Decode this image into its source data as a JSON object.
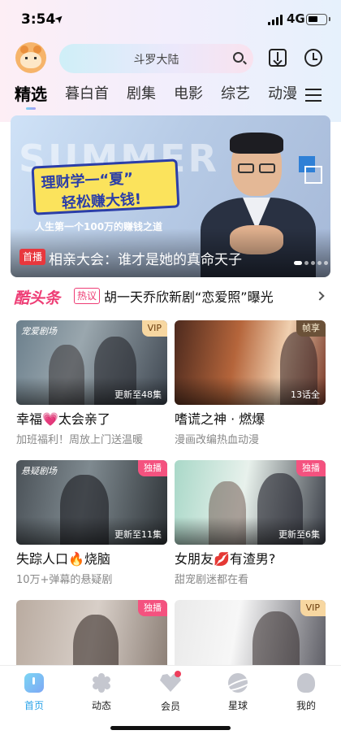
{
  "status_bar": {
    "time": "3:54",
    "network": "4G"
  },
  "header": {
    "search_placeholder": "斗罗大陆"
  },
  "tabs": [
    {
      "label": "精选",
      "active": true
    },
    {
      "label": "暮白首",
      "active": false
    },
    {
      "label": "剧集",
      "active": false
    },
    {
      "label": "电影",
      "active": false
    },
    {
      "label": "综艺",
      "active": false
    },
    {
      "label": "动漫",
      "active": false
    }
  ],
  "banner": {
    "bg_text": "SUMMER",
    "promo_line1": "理财学一“夏”",
    "promo_line2": "轻松赚大钱!",
    "promo_sub": "人生第一个100万的赚钱之道",
    "badge": "首播",
    "title": "相亲大会：谁才是她的真命天子",
    "pages": 5,
    "current_page": 1
  },
  "headline": {
    "logo": "酷头条",
    "tag": "热议",
    "text": "胡一天乔欣新剧“恋爱照”曝光"
  },
  "cards": [
    {
      "title": "幸福💗太会亲了",
      "subtitle": "加班福利！周放上门送温暖",
      "badge": "VIP",
      "badge_type": "vip",
      "episode": "更新至48集",
      "logo": "宠爱剧场"
    },
    {
      "title": "嗜谎之神 · 燃爆",
      "subtitle": "漫画改编热血动漫",
      "badge": "帧享",
      "badge_type": "dark",
      "episode": "13话全",
      "logo": ""
    },
    {
      "title": "失踪人口🔥烧脑",
      "subtitle": "10万+弹幕的悬疑剧",
      "badge": "独播",
      "badge_type": "excl",
      "episode": "更新至11集",
      "logo": "悬疑剧场"
    },
    {
      "title": "女朋友💋有渣男?",
      "subtitle": "甜宠剧迷都在看",
      "badge": "独播",
      "badge_type": "excl",
      "episode": "更新至6集",
      "logo": ""
    },
    {
      "title": "",
      "subtitle": "",
      "badge": "独播",
      "badge_type": "excl",
      "episode": "",
      "logo": ""
    },
    {
      "title": "",
      "subtitle": "",
      "badge": "VIP",
      "badge_type": "vip",
      "episode": "",
      "logo": ""
    }
  ],
  "bottom_nav": [
    {
      "label": "首页",
      "icon": "home-icon",
      "active": true
    },
    {
      "label": "动态",
      "icon": "pinwheel-icon",
      "active": false
    },
    {
      "label": "会员",
      "icon": "vip-heart-icon",
      "active": false
    },
    {
      "label": "星球",
      "icon": "planet-icon",
      "active": false
    },
    {
      "label": "我的",
      "icon": "profile-icon",
      "active": false
    }
  ],
  "colors": {
    "accent_pink": "#ee3d75",
    "accent_blue": "#2ba3e8",
    "badge_red": "#e8373d"
  }
}
